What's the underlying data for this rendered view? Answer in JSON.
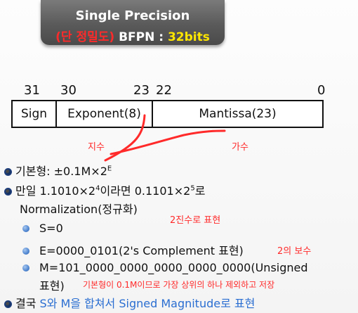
{
  "banner": {
    "title": "Single Precision",
    "subtitle_korean": "(단 정밀도)",
    "subtitle_mid": " BFPN : ",
    "subtitle_bits": "32bits"
  },
  "bit_labels": {
    "b31": "31",
    "b30": "30",
    "b23": "23",
    "b22": "22",
    "b0": "0"
  },
  "register": {
    "sign": "Sign",
    "exponent": "Exponent(8)",
    "mantissa": "Mantissa(23)"
  },
  "annotations": {
    "exponent_kr": "지수",
    "mantissa_kr": "가수",
    "binary_note": "2진수로 표현",
    "twos_note": "2의 보수",
    "unsigned_note": "기본형이 0.1M이므로 가장 상위의 하나 제외하고 저장"
  },
  "bullets": {
    "basic_prefix": "기본형: ±0.1M×2",
    "basic_sup": "E",
    "if_prefix": "만일 1.1010×2",
    "if_sup1": "4",
    "if_mid": "이라면 0.1101×2",
    "if_sup2": "5",
    "if_suffix": "로",
    "normalization": "Normalization(정규화)",
    "s_line": "S=0",
    "e_line": "E=0000_0101(2's Complement 표현)",
    "m_line": "M=101_0000_0000_0000_0000_0000(Unsigned",
    "m_line2": "표현)",
    "conclusion_prefix": "결국 ",
    "conclusion_blue": "S와 M을 합쳐서 Signed Magnitude로 표현"
  }
}
